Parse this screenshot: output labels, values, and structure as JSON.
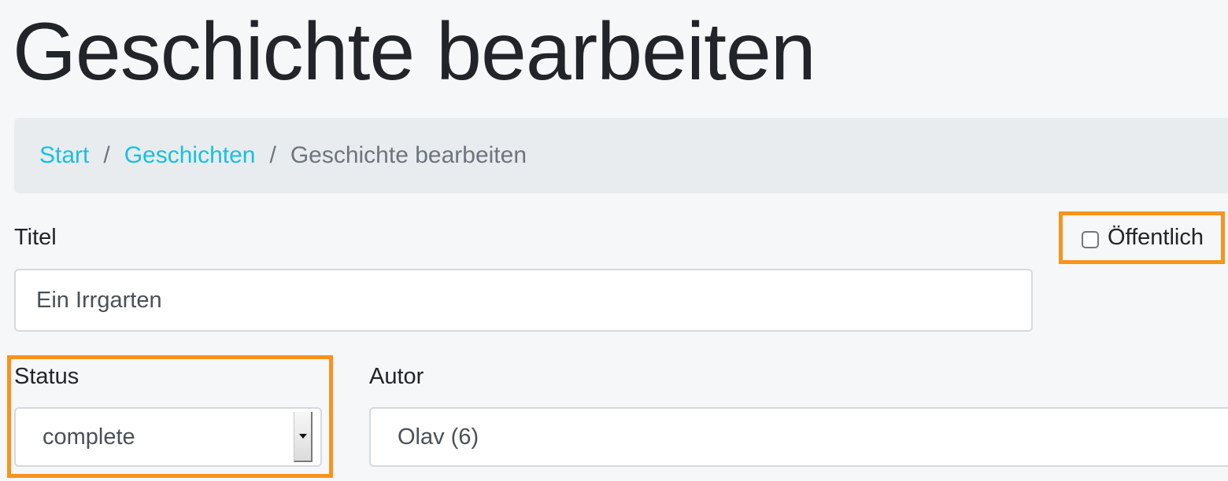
{
  "page": {
    "title": "Geschichte bearbeiten"
  },
  "breadcrumb": {
    "items": [
      {
        "label": "Start",
        "link": true
      },
      {
        "label": "Geschichten",
        "link": true
      },
      {
        "label": "Geschichte bearbeiten",
        "link": false
      }
    ],
    "separator": "/"
  },
  "form": {
    "title_label": "Titel",
    "title_value": "Ein Irrgarten",
    "public_label": "Öffentlich",
    "public_checked": false,
    "status_label": "Status",
    "status_value": "complete",
    "author_label": "Autor",
    "author_value": "Olav (6)"
  },
  "colors": {
    "link": "#17c1e0",
    "highlight": "#f7931e",
    "breadcrumb_bg": "#e9ecef",
    "page_bg": "#f6f7f9"
  }
}
